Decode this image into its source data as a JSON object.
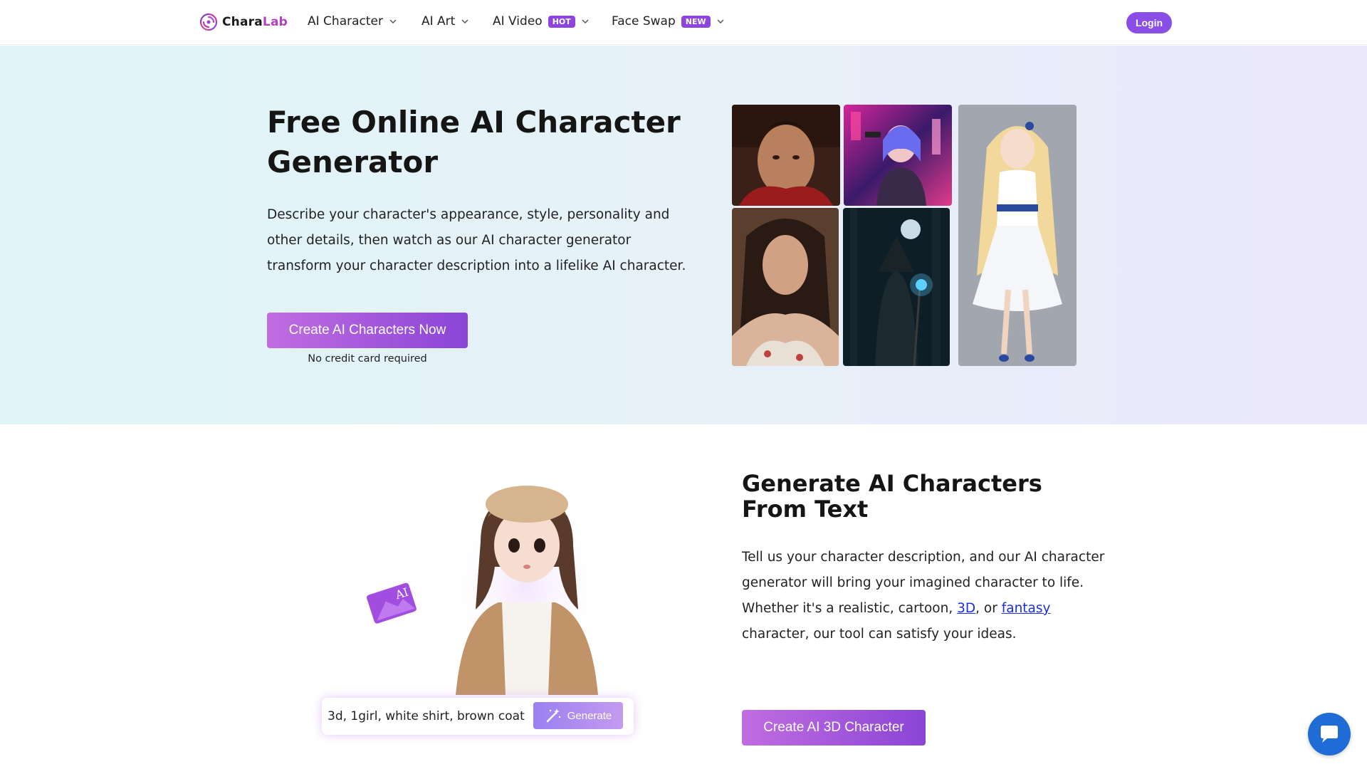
{
  "nav": {
    "brand_a": "Chara",
    "brand_b": "Lab",
    "items": [
      {
        "label": "AI Character",
        "badge": ""
      },
      {
        "label": "AI Art",
        "badge": ""
      },
      {
        "label": "AI Video",
        "badge": "HOT"
      },
      {
        "label": "Face Swap",
        "badge": "NEW"
      }
    ],
    "login_label": "Login"
  },
  "hero": {
    "title": "Free Online AI Character Generator",
    "description": "Describe your character's appearance, style, personality and other details, then watch as our AI character generator transform your character description into a lifelike AI character.",
    "cta_label": "Create AI Characters Now",
    "note": "No credit card required"
  },
  "section2": {
    "title": "Generate AI Characters From Text",
    "desc_part1": "Tell us your character description, and our AI character generator will bring your imagined character to life. Whether it's a realistic, cartoon, ",
    "link_3d": "3D",
    "desc_part2": ", or ",
    "link_fantasy": "fantasy",
    "desc_part3": " character, our tool can satisfy your ideas.",
    "cta_label": "Create AI 3D Character",
    "ai_tag": "AI",
    "prompt_text": "3d, 1girl, white shirt, brown coat",
    "generate_label": "Generate"
  },
  "colors": {
    "accent": "#8a4de6",
    "link": "#1a2fe0",
    "chat": "#1f6cd6"
  },
  "icons": [
    "brand-logo-icon",
    "chevron-down-icon",
    "magic-wand-icon",
    "chat-bubble-icon"
  ]
}
